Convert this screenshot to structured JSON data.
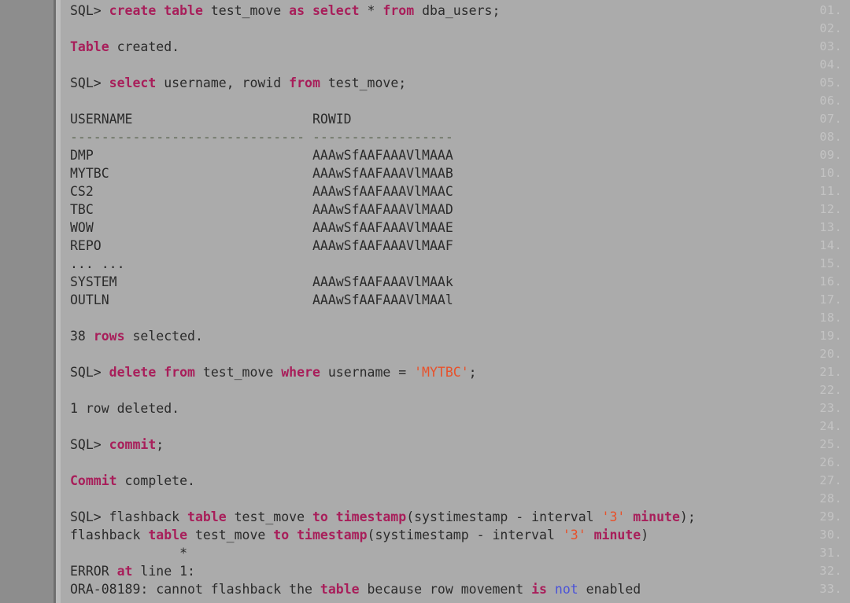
{
  "viewer": {
    "background_color": "#ababab",
    "gutter_color": "#8d8d8d",
    "line_number_color": "#c3c3c3",
    "text_color": "#2b2b2b",
    "keyword_color": "#a81e5a",
    "string_color": "#e8512a",
    "blue_token_color": "#4a52d8",
    "separator_color": "#5c6652",
    "total_lines": 33
  },
  "line_numbers": [
    "01.",
    "02.",
    "03.",
    "04.",
    "05.",
    "06.",
    "07.",
    "08.",
    "09.",
    "10.",
    "11.",
    "12.",
    "13.",
    "14.",
    "15.",
    "16.",
    "17.",
    "18.",
    "19.",
    "20.",
    "21.",
    "22.",
    "23.",
    "24.",
    "25.",
    "26.",
    "27.",
    "28.",
    "29.",
    "30.",
    "31.",
    "32.",
    "33."
  ],
  "lines": [
    {
      "n": 1,
      "tokens": [
        {
          "t": "SQL> ",
          "c": "plain"
        },
        {
          "t": "create table",
          "c": "kw"
        },
        {
          "t": " test_move ",
          "c": "plain"
        },
        {
          "t": "as select",
          "c": "kw"
        },
        {
          "t": " * ",
          "c": "plain"
        },
        {
          "t": "from",
          "c": "kw"
        },
        {
          "t": " dba_users;",
          "c": "plain"
        }
      ]
    },
    {
      "n": 2,
      "tokens": []
    },
    {
      "n": 3,
      "tokens": [
        {
          "t": "Table",
          "c": "kw"
        },
        {
          "t": " created.",
          "c": "plain"
        }
      ]
    },
    {
      "n": 4,
      "tokens": []
    },
    {
      "n": 5,
      "tokens": [
        {
          "t": "SQL> ",
          "c": "plain"
        },
        {
          "t": "select",
          "c": "kw"
        },
        {
          "t": " username, rowid ",
          "c": "plain"
        },
        {
          "t": "from",
          "c": "kw"
        },
        {
          "t": " test_move;",
          "c": "plain"
        }
      ]
    },
    {
      "n": 6,
      "tokens": []
    },
    {
      "n": 7,
      "tokens": [
        {
          "t": "USERNAME                       ROWID",
          "c": "plain"
        }
      ]
    },
    {
      "n": 8,
      "tokens": [
        {
          "t": "------------------------------ ------------------",
          "c": "dash"
        }
      ]
    },
    {
      "n": 9,
      "tokens": [
        {
          "t": "DMP                            AAAwSfAAFAAAVlMAAA",
          "c": "plain"
        }
      ]
    },
    {
      "n": 10,
      "tokens": [
        {
          "t": "MYTBC                          AAAwSfAAFAAAVlMAAB",
          "c": "plain"
        }
      ]
    },
    {
      "n": 11,
      "tokens": [
        {
          "t": "CS2                            AAAwSfAAFAAAVlMAAC",
          "c": "plain"
        }
      ]
    },
    {
      "n": 12,
      "tokens": [
        {
          "t": "TBC                            AAAwSfAAFAAAVlMAAD",
          "c": "plain"
        }
      ]
    },
    {
      "n": 13,
      "tokens": [
        {
          "t": "WOW                            AAAwSfAAFAAAVlMAAE",
          "c": "plain"
        }
      ]
    },
    {
      "n": 14,
      "tokens": [
        {
          "t": "REPO                           AAAwSfAAFAAAVlMAAF",
          "c": "plain"
        }
      ]
    },
    {
      "n": 15,
      "tokens": [
        {
          "t": "... ...",
          "c": "plain"
        }
      ]
    },
    {
      "n": 16,
      "tokens": [
        {
          "t": "SYSTEM                         AAAwSfAAFAAAVlMAAk",
          "c": "plain"
        }
      ]
    },
    {
      "n": 17,
      "tokens": [
        {
          "t": "OUTLN                          AAAwSfAAFAAAVlMAAl",
          "c": "plain"
        }
      ]
    },
    {
      "n": 18,
      "tokens": []
    },
    {
      "n": 19,
      "tokens": [
        {
          "t": "38 ",
          "c": "plain"
        },
        {
          "t": "rows",
          "c": "kw"
        },
        {
          "t": " selected.",
          "c": "plain"
        }
      ]
    },
    {
      "n": 20,
      "tokens": []
    },
    {
      "n": 21,
      "tokens": [
        {
          "t": "SQL> ",
          "c": "plain"
        },
        {
          "t": "delete from",
          "c": "kw"
        },
        {
          "t": " test_move ",
          "c": "plain"
        },
        {
          "t": "where",
          "c": "kw"
        },
        {
          "t": " username = ",
          "c": "plain"
        },
        {
          "t": "'MYTBC'",
          "c": "str"
        },
        {
          "t": ";",
          "c": "plain"
        }
      ]
    },
    {
      "n": 22,
      "tokens": []
    },
    {
      "n": 23,
      "tokens": [
        {
          "t": "1 row deleted.",
          "c": "plain"
        }
      ]
    },
    {
      "n": 24,
      "tokens": []
    },
    {
      "n": 25,
      "tokens": [
        {
          "t": "SQL> ",
          "c": "plain"
        },
        {
          "t": "commit",
          "c": "kw"
        },
        {
          "t": ";",
          "c": "plain"
        }
      ]
    },
    {
      "n": 26,
      "tokens": []
    },
    {
      "n": 27,
      "tokens": [
        {
          "t": "Commit",
          "c": "kw"
        },
        {
          "t": " complete.",
          "c": "plain"
        }
      ]
    },
    {
      "n": 28,
      "tokens": []
    },
    {
      "n": 29,
      "tokens": [
        {
          "t": "SQL> flashback ",
          "c": "plain"
        },
        {
          "t": "table",
          "c": "kw"
        },
        {
          "t": " test_move ",
          "c": "plain"
        },
        {
          "t": "to timestamp",
          "c": "kw"
        },
        {
          "t": "(systimestamp - interval ",
          "c": "plain"
        },
        {
          "t": "'3'",
          "c": "str"
        },
        {
          "t": " ",
          "c": "plain"
        },
        {
          "t": "minute",
          "c": "kw"
        },
        {
          "t": ");",
          "c": "plain"
        }
      ]
    },
    {
      "n": 30,
      "tokens": [
        {
          "t": "flashback ",
          "c": "plain"
        },
        {
          "t": "table",
          "c": "kw"
        },
        {
          "t": " test_move ",
          "c": "plain"
        },
        {
          "t": "to timestamp",
          "c": "kw"
        },
        {
          "t": "(systimestamp - interval ",
          "c": "plain"
        },
        {
          "t": "'3'",
          "c": "str"
        },
        {
          "t": " ",
          "c": "plain"
        },
        {
          "t": "minute",
          "c": "kw"
        },
        {
          "t": ")",
          "c": "plain"
        }
      ]
    },
    {
      "n": 31,
      "tokens": [
        {
          "t": "              *",
          "c": "plain"
        }
      ]
    },
    {
      "n": 32,
      "tokens": [
        {
          "t": "ERROR ",
          "c": "plain"
        },
        {
          "t": "at",
          "c": "kw"
        },
        {
          "t": " line 1:",
          "c": "plain"
        }
      ]
    },
    {
      "n": 33,
      "tokens": [
        {
          "t": "ORA-08189: cannot flashback the ",
          "c": "plain"
        },
        {
          "t": "table",
          "c": "kw"
        },
        {
          "t": " because row movement ",
          "c": "plain"
        },
        {
          "t": "is",
          "c": "kw"
        },
        {
          "t": " ",
          "c": "plain"
        },
        {
          "t": "not",
          "c": "blue"
        },
        {
          "t": " enabled",
          "c": "plain"
        }
      ]
    }
  ]
}
